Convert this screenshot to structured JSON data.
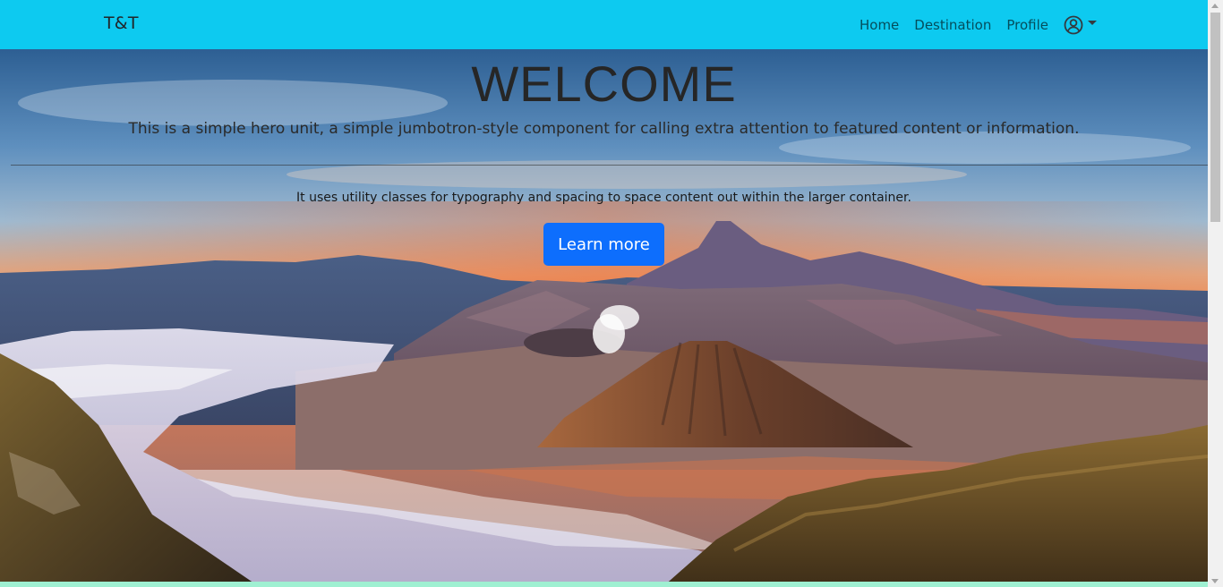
{
  "navbar": {
    "brand": "T&T",
    "links": [
      {
        "label": "Home"
      },
      {
        "label": "Destination"
      },
      {
        "label": "Profile"
      }
    ],
    "account_icon": "user-circle-icon",
    "dropdown_icon": "caret-down-icon",
    "background_color": "#0dcaf0"
  },
  "hero": {
    "title": "WELCOME",
    "lead": "This is a simple hero unit, a simple jumbotron-style component for calling extra attention to featured content or information.",
    "text": "It uses utility classes for typography and spacing to space content out within the larger container.",
    "button_label": "Learn more",
    "button_color": "#0d6efd"
  }
}
